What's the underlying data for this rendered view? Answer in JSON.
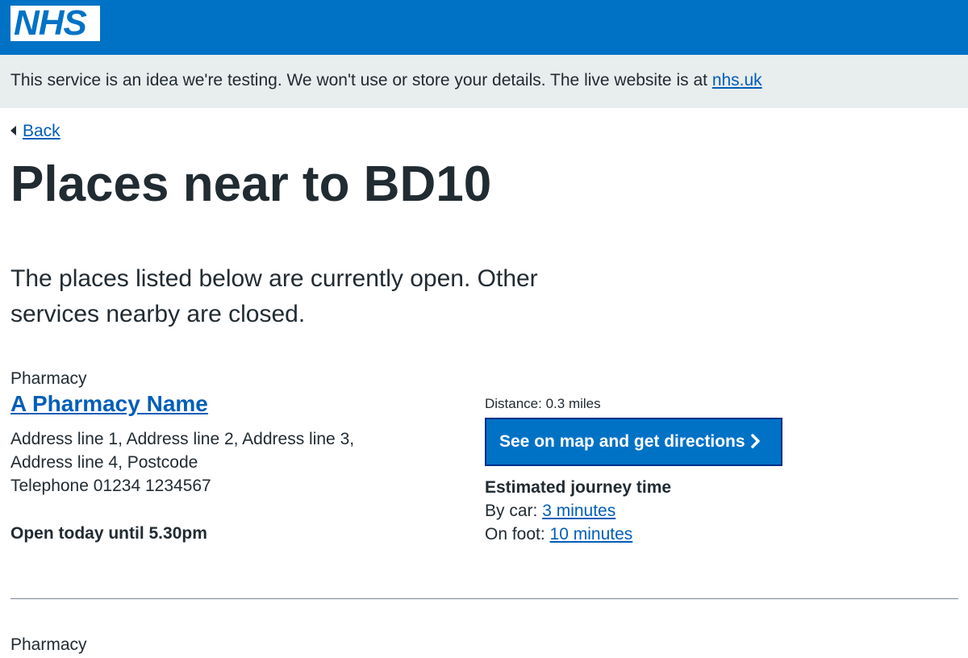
{
  "header": {
    "logo_text": "NHS",
    "brand_color": "#0072c6"
  },
  "banner": {
    "text": "This service is an idea we're testing. We won't use or store your details. The live website is at ",
    "link_label": "nhs.uk"
  },
  "back": {
    "label": "Back",
    "icon": "chevron-left-icon"
  },
  "page": {
    "title": "Places near to BD10",
    "lead": "The places listed below are currently open. Other services nearby are closed."
  },
  "results": [
    {
      "type": "Pharmacy",
      "name": "A Pharmacy Name",
      "address": "Address line 1, Address line 2, Address line 3, Address line 4, Postcode",
      "telephone": "Telephone 01234 1234567",
      "open_status": "Open today until 5.30pm",
      "distance": "Distance: 0.3 miles",
      "map_button_label": "See on map and get directions",
      "map_button_icon": "chevron-right-icon",
      "journey_heading": "Estimated journey time",
      "by_car_label": "By car: ",
      "by_car_value": "3 minutes",
      "on_foot_label": "On foot: ",
      "on_foot_value": "10 minutes"
    },
    {
      "type": "Pharmacy"
    }
  ]
}
